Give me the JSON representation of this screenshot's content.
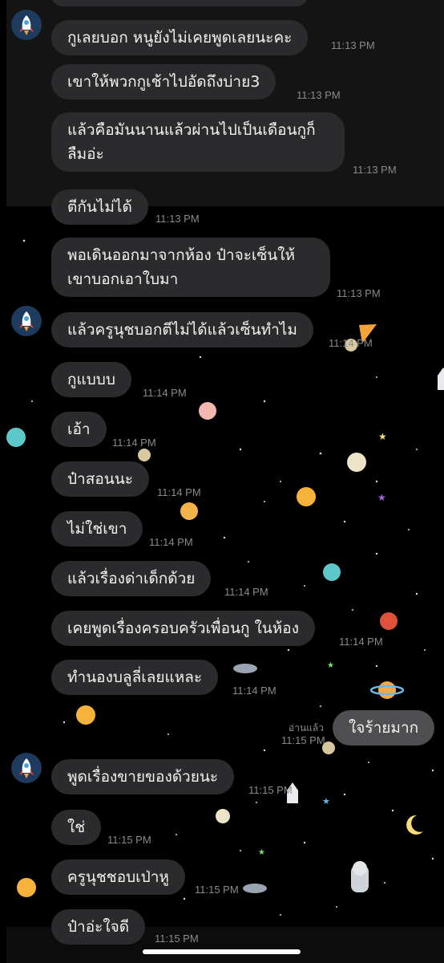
{
  "chat": {
    "avatar_icon": "rocket-icon",
    "messages": [
      {
        "text": "กูเลยบอก หนูยังไม่เคยพูดเลยนะคะ",
        "time": "11:13 PM"
      },
      {
        "text": "เขาให้พวกกูเช้าไปอัดถึงบ่าย3",
        "time": "11:13 PM"
      },
      {
        "text": "แล้วคือมันนานแล้วผ่านไปเป็นเดือนกูก็ลืมอ่ะ",
        "time": "11:13 PM"
      },
      {
        "text": "ตีกันไม่ได้",
        "time": "11:13 PM"
      },
      {
        "text": "พอเดินออกมาจากห้อง ป๋าจะเซ็นให้ เขาบอกเอาใบมา",
        "time": "11:13 PM"
      },
      {
        "text": "แล้วครูนุชบอกตีไม่ได้แล้วเซ็นทำไม",
        "time": "11:14 PM"
      },
      {
        "text": "กูแบบบ",
        "time": "11:14 PM"
      },
      {
        "text": "เอ้า",
        "time": "11:14 PM"
      },
      {
        "text": "ป๋าสอนนะ",
        "time": "11:14 PM"
      },
      {
        "text": "ไม่ใช่เขา",
        "time": "11:14 PM"
      },
      {
        "text": "แล้วเรื่องด่าเด็กด้วย",
        "time": "11:14 PM"
      },
      {
        "text": "เคยพูดเรื่องครอบครัวเพื่อนกู ในห้อง",
        "time": "11:14 PM"
      },
      {
        "text": "ทำนองบลูลี่เลยแหละ",
        "time": "11:14 PM"
      },
      {
        "text": "พูดเรื่องขายของด้วยนะ",
        "time": "11:15 PM"
      },
      {
        "text": "ใช่",
        "time": "11:15 PM"
      },
      {
        "text": "ครูนุชชอบเป่าหู",
        "time": "11:15 PM"
      },
      {
        "text": "ป๋าอ่ะใจดี",
        "time": "11:15 PM"
      }
    ],
    "sent": {
      "text": "ใจร้ายมาก",
      "read_label": "อ่านแล้ว",
      "time": "11:15 PM"
    }
  }
}
